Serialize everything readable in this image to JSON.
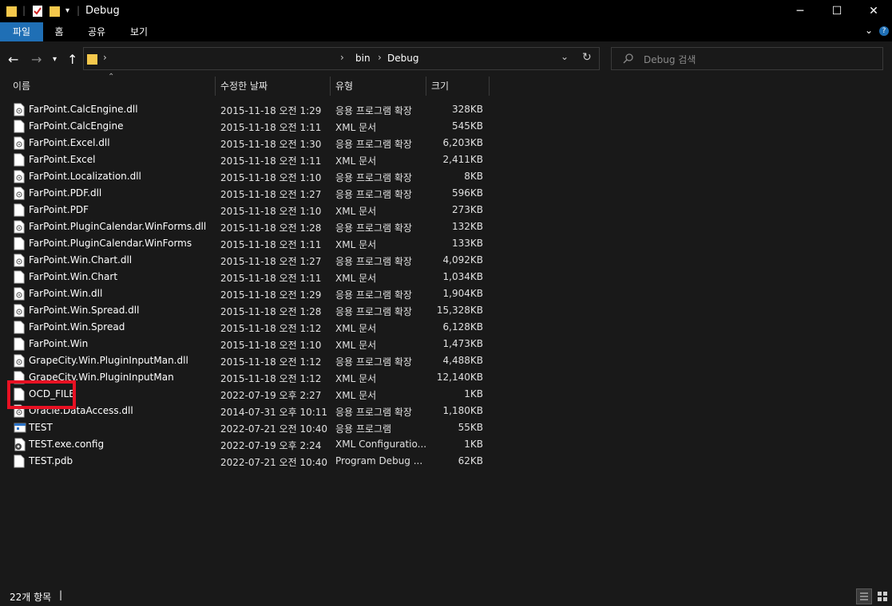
{
  "window": {
    "title": "Debug",
    "minimize_glyph": "─",
    "maximize_glyph": "☐",
    "close_glyph": "✕"
  },
  "ribbon": {
    "tabs": [
      "파일",
      "홈",
      "공유",
      "보기"
    ]
  },
  "address": {
    "path": [
      "bin",
      "Debug"
    ],
    "separator": "›"
  },
  "search": {
    "placeholder": "Debug 검색"
  },
  "columns": {
    "name": "이름",
    "modified": "수정한 날짜",
    "type": "유형",
    "size": "크기"
  },
  "files": [
    {
      "name": "FarPoint.CalcEngine.dll",
      "modified": "2015-11-18 오전 1:29",
      "type": "응용 프로그램 확장",
      "size": "328KB",
      "icon": "dll-icon"
    },
    {
      "name": "FarPoint.CalcEngine",
      "modified": "2015-11-18 오전 1:11",
      "type": "XML 문서",
      "size": "545KB",
      "icon": "file-icon"
    },
    {
      "name": "FarPoint.Excel.dll",
      "modified": "2015-11-18 오전 1:30",
      "type": "응용 프로그램 확장",
      "size": "6,203KB",
      "icon": "dll-icon"
    },
    {
      "name": "FarPoint.Excel",
      "modified": "2015-11-18 오전 1:11",
      "type": "XML 문서",
      "size": "2,411KB",
      "icon": "file-icon"
    },
    {
      "name": "FarPoint.Localization.dll",
      "modified": "2015-11-18 오전 1:10",
      "type": "응용 프로그램 확장",
      "size": "8KB",
      "icon": "dll-icon"
    },
    {
      "name": "FarPoint.PDF.dll",
      "modified": "2015-11-18 오전 1:27",
      "type": "응용 프로그램 확장",
      "size": "596KB",
      "icon": "dll-icon"
    },
    {
      "name": "FarPoint.PDF",
      "modified": "2015-11-18 오전 1:10",
      "type": "XML 문서",
      "size": "273KB",
      "icon": "file-icon"
    },
    {
      "name": "FarPoint.PluginCalendar.WinForms.dll",
      "modified": "2015-11-18 오전 1:28",
      "type": "응용 프로그램 확장",
      "size": "132KB",
      "icon": "dll-icon"
    },
    {
      "name": "FarPoint.PluginCalendar.WinForms",
      "modified": "2015-11-18 오전 1:11",
      "type": "XML 문서",
      "size": "133KB",
      "icon": "file-icon"
    },
    {
      "name": "FarPoint.Win.Chart.dll",
      "modified": "2015-11-18 오전 1:27",
      "type": "응용 프로그램 확장",
      "size": "4,092KB",
      "icon": "dll-icon"
    },
    {
      "name": "FarPoint.Win.Chart",
      "modified": "2015-11-18 오전 1:11",
      "type": "XML 문서",
      "size": "1,034KB",
      "icon": "file-icon"
    },
    {
      "name": "FarPoint.Win.dll",
      "modified": "2015-11-18 오전 1:29",
      "type": "응용 프로그램 확장",
      "size": "1,904KB",
      "icon": "dll-icon"
    },
    {
      "name": "FarPoint.Win.Spread.dll",
      "modified": "2015-11-18 오전 1:28",
      "type": "응용 프로그램 확장",
      "size": "15,328KB",
      "icon": "dll-icon"
    },
    {
      "name": "FarPoint.Win.Spread",
      "modified": "2015-11-18 오전 1:12",
      "type": "XML 문서",
      "size": "6,128KB",
      "icon": "file-icon"
    },
    {
      "name": "FarPoint.Win",
      "modified": "2015-11-18 오전 1:10",
      "type": "XML 문서",
      "size": "1,473KB",
      "icon": "file-icon"
    },
    {
      "name": "GrapeCity.Win.PluginInputMan.dll",
      "modified": "2015-11-18 오전 1:12",
      "type": "응용 프로그램 확장",
      "size": "4,488KB",
      "icon": "dll-icon"
    },
    {
      "name": "GrapeCity.Win.PluginInputMan",
      "modified": "2015-11-18 오전 1:12",
      "type": "XML 문서",
      "size": "12,140KB",
      "icon": "file-icon"
    },
    {
      "name": "OCD_FILE",
      "modified": "2022-07-19 오후 2:27",
      "type": "XML 문서",
      "size": "1KB",
      "icon": "file-icon"
    },
    {
      "name": "Oracle.DataAccess.dll",
      "modified": "2014-07-31 오후 10:11",
      "type": "응용 프로그램 확장",
      "size": "1,180KB",
      "icon": "dll-icon"
    },
    {
      "name": "TEST",
      "modified": "2022-07-21 오전 10:40",
      "type": "응용 프로그램",
      "size": "55KB",
      "icon": "exe-icon"
    },
    {
      "name": "TEST.exe.config",
      "modified": "2022-07-19 오후 2:24",
      "type": "XML Configuratio...",
      "size": "1KB",
      "icon": "config-icon"
    },
    {
      "name": "TEST.pdb",
      "modified": "2022-07-21 오전 10:40",
      "type": "Program Debug ...",
      "size": "62KB",
      "icon": "file-icon"
    }
  ],
  "status": {
    "count": "22개 항목"
  },
  "colors": {
    "highlight": "#e81123",
    "active_tab": "#1f6fb5"
  }
}
